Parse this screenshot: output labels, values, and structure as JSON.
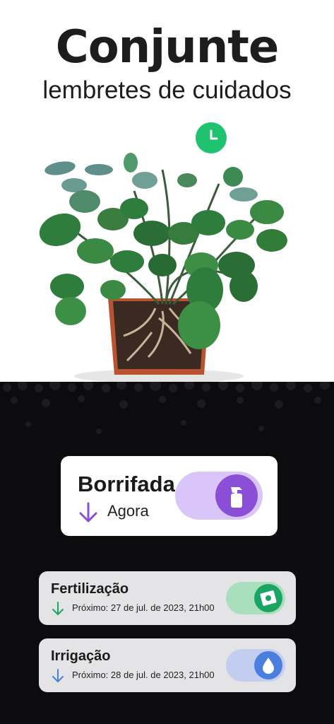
{
  "header": {
    "title": "Conjunte",
    "subtitle": "lembretes de cuidados"
  },
  "colors": {
    "clock_badge": "#1fc36f",
    "spray_pill": "#d9c5f7",
    "spray_button": "#8a4fd6",
    "fert_pill": "#a9dfbd",
    "fert_button": "#1aa562",
    "water_pill": "#c2cdf0",
    "water_button": "#4a7fe0",
    "soil": "#0c0c0f"
  },
  "reminders": [
    {
      "name": "Borrifada",
      "when": "Agora",
      "arrow_color": "#8a4fd6",
      "icon": "spray-bottle-icon"
    },
    {
      "name": "Fertilização",
      "next": "Próximo: 27 de jul. de 2023, 21h00",
      "arrow_color": "#1aa562",
      "icon": "fertilizer-packet-icon"
    },
    {
      "name": "Irrigação",
      "next": "Próximo: 28 de jul. de 2023, 21h00",
      "arrow_color": "#4a7fe0",
      "icon": "water-drop-icon"
    }
  ]
}
